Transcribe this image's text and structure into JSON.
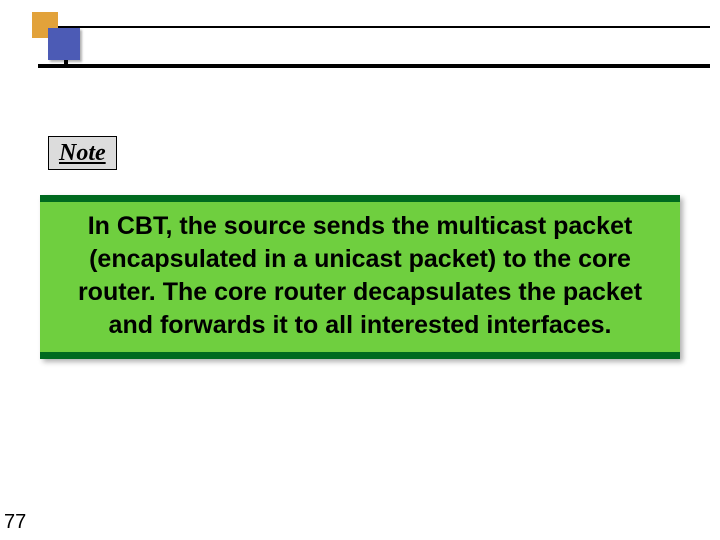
{
  "note_label": "Note",
  "content_text": "In CBT, the source sends the multicast packet (encapsulated in a unicast packet) to the core router. The core router decapsulates the packet and forwards it to all interested interfaces.",
  "page_number": "77"
}
